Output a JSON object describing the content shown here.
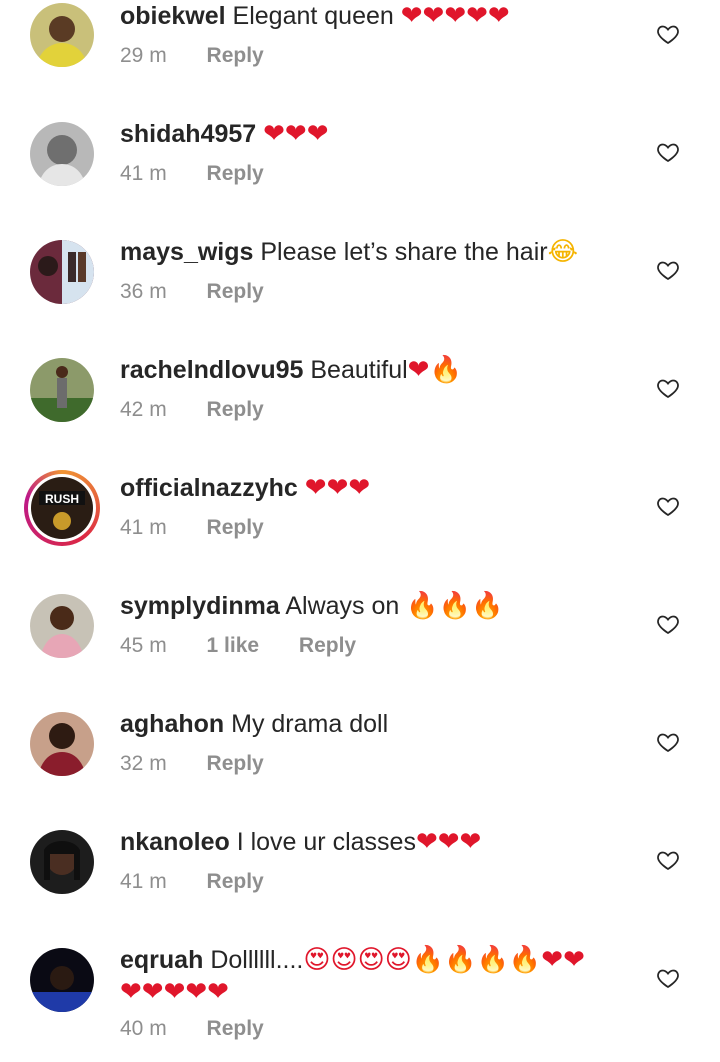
{
  "comments": [
    {
      "username": "obiekwel",
      "text": "Elegant queen",
      "emojis": "❤❤❤❤❤",
      "time": "29 m",
      "likes": "",
      "reply": "Reply"
    },
    {
      "username": "shidah4957",
      "text": "",
      "emojis": "❤❤❤",
      "time": "41 m",
      "likes": "",
      "reply": "Reply"
    },
    {
      "username": "mays_wigs",
      "text": "Please let’s share the hair",
      "emojis": "😂",
      "time": "36 m",
      "likes": "",
      "reply": "Reply"
    },
    {
      "username": "rachelndlovu95",
      "text": "Beautiful",
      "emojis": "❤🔥",
      "time": "42 m",
      "likes": "",
      "reply": "Reply"
    },
    {
      "username": "officialnazzyhc",
      "text": "",
      "emojis": "❤❤❤",
      "time": "41 m",
      "likes": "",
      "reply": "Reply",
      "avatar_text": "RUSH"
    },
    {
      "username": "symplydinma",
      "text": "Always on",
      "emojis": "🔥🔥🔥",
      "time": "45 m",
      "likes": "1 like",
      "reply": "Reply"
    },
    {
      "username": "aghahon",
      "text": "My drama doll",
      "emojis": "",
      "time": "32 m",
      "likes": "",
      "reply": "Reply"
    },
    {
      "username": "nkanoleo",
      "text": "I love ur classes",
      "emojis": "❤❤❤",
      "time": "41 m",
      "likes": "",
      "reply": "Reply"
    },
    {
      "username": "eqruah",
      "text": "Dollllll....",
      "emojis": "😍😍😍😍🔥🔥🔥🔥❤❤",
      "emojis_line2": "❤❤❤❤❤",
      "time": "40 m",
      "likes": "",
      "reply": "Reply"
    }
  ],
  "icons": {
    "like": "heart-outline-icon"
  },
  "colors": {
    "heart": "#e0162b",
    "fire": "#f29a1b",
    "meta": "#8e8e8e",
    "text": "#262626"
  }
}
